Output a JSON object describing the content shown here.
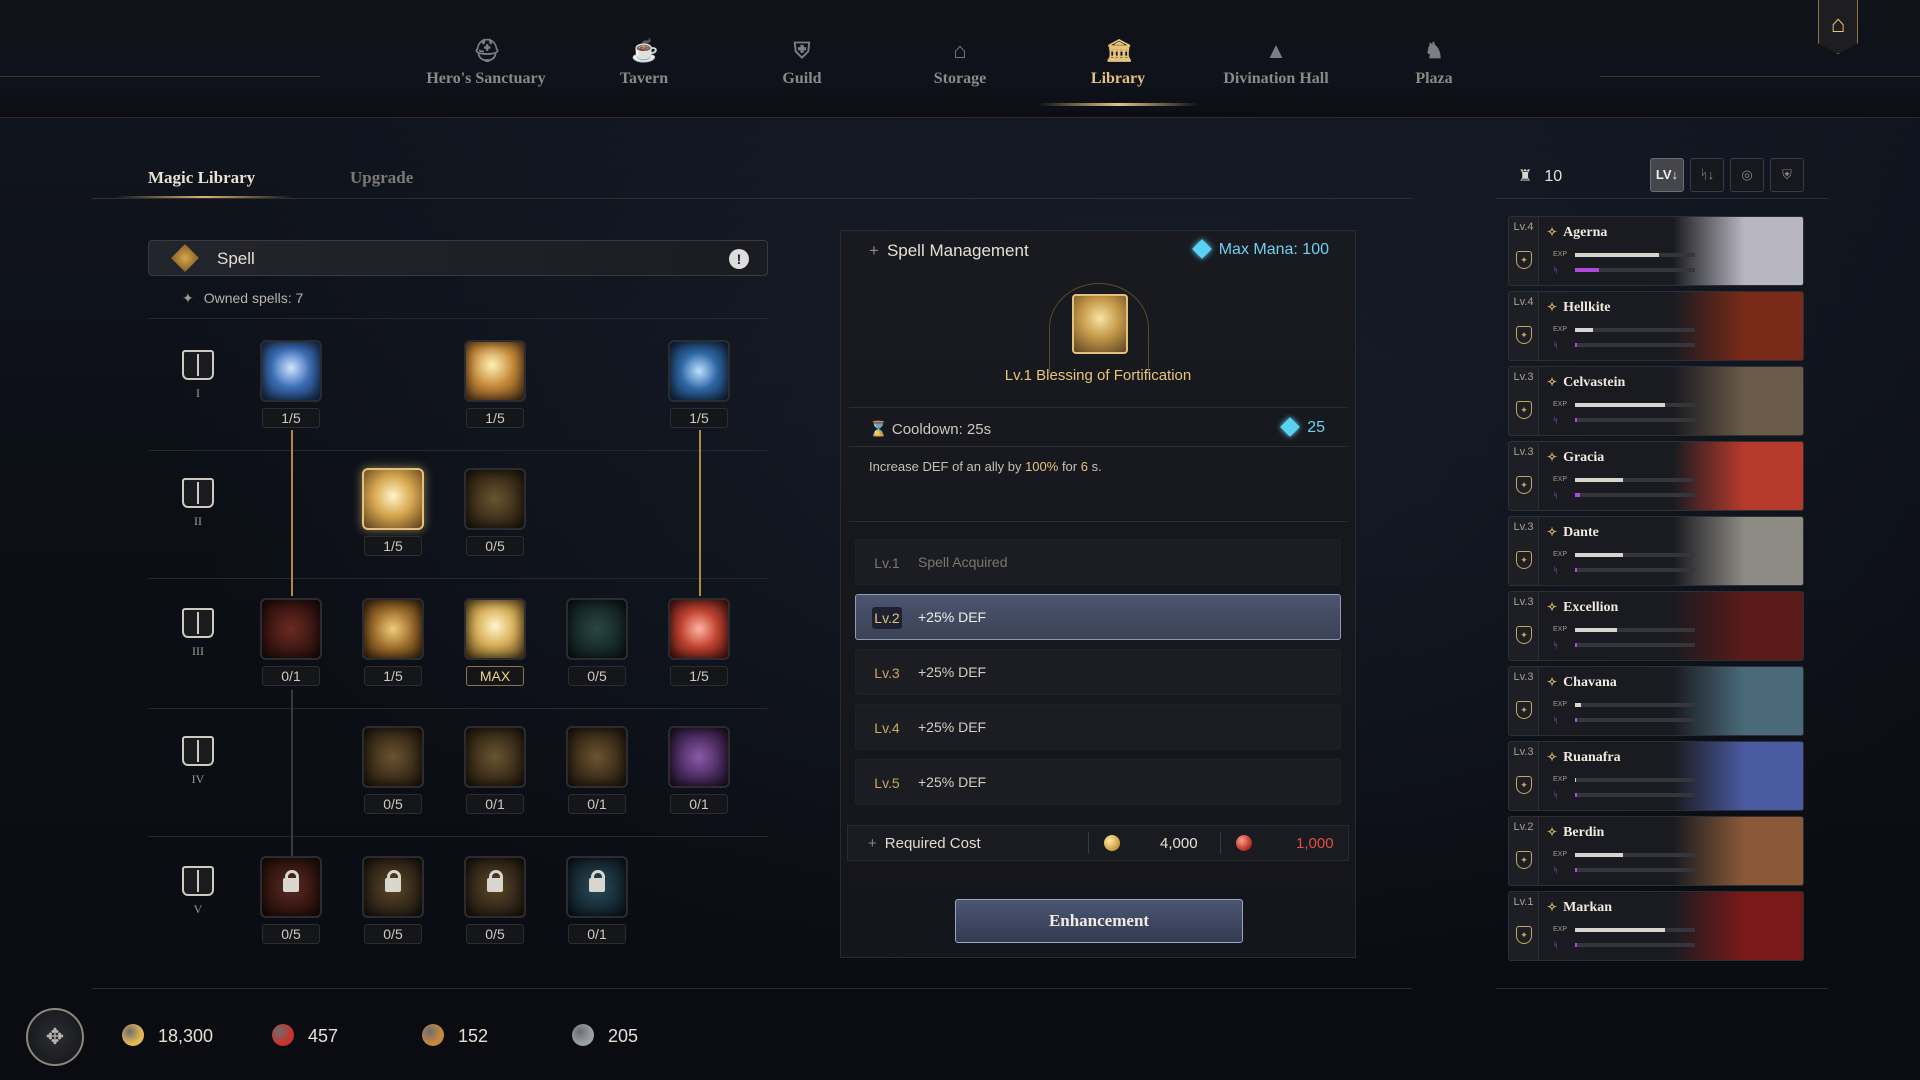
{
  "nav": {
    "items": [
      {
        "label": "Hero's Sanctuary",
        "icon": "helmet-icon"
      },
      {
        "label": "Tavern",
        "icon": "mug-icon"
      },
      {
        "label": "Guild",
        "icon": "shield-icon"
      },
      {
        "label": "Storage",
        "icon": "vault-icon"
      },
      {
        "label": "Library",
        "icon": "library-icon"
      },
      {
        "label": "Divination Hall",
        "icon": "witch-hat-icon"
      },
      {
        "label": "Plaza",
        "icon": "dragon-statue-icon"
      }
    ],
    "active": "Library"
  },
  "tabs": {
    "magic_library": "Magic Library",
    "upgrade": "Upgrade"
  },
  "spell_panel": {
    "title": "Spell",
    "owned": "Owned spells: 7",
    "tiers": [
      "I",
      "II",
      "III",
      "IV",
      "V"
    ],
    "nodes": [
      {
        "tier": "I",
        "count": "1/5",
        "color": "blue-swirl"
      },
      {
        "tier": "I",
        "count": "1/5",
        "color": "gold-burst"
      },
      {
        "tier": "I",
        "count": "1/5",
        "color": "blue-wave"
      },
      {
        "tier": "II",
        "count": "1/5",
        "color": "gold-figure",
        "selected": true
      },
      {
        "tier": "II",
        "count": "0/5",
        "color": "bronze"
      },
      {
        "tier": "III",
        "count": "0/1",
        "color": "dark-red"
      },
      {
        "tier": "III",
        "count": "1/5",
        "color": "gold-rune"
      },
      {
        "tier": "III",
        "count": "MAX",
        "color": "gold-wing"
      },
      {
        "tier": "III",
        "count": "0/5",
        "color": "dark-teal"
      },
      {
        "tier": "III",
        "count": "1/5",
        "color": "red-shield"
      },
      {
        "tier": "IV",
        "count": "0/5",
        "color": "bronze"
      },
      {
        "tier": "IV",
        "count": "0/1",
        "color": "bronze"
      },
      {
        "tier": "IV",
        "count": "0/1",
        "color": "bronze"
      },
      {
        "tier": "IV",
        "count": "0/1",
        "color": "purple"
      },
      {
        "tier": "V",
        "count": "0/5",
        "color": "red-locked"
      },
      {
        "tier": "V",
        "count": "0/5",
        "color": "bronze-locked"
      },
      {
        "tier": "V",
        "count": "0/5",
        "color": "bronze-locked"
      },
      {
        "tier": "V",
        "count": "0/1",
        "color": "teal-locked"
      }
    ]
  },
  "management": {
    "title": "Spell Management",
    "max_mana": "Max Mana: 100",
    "spell_name": "Lv.1 Blessing of Fortification",
    "cooldown": "Cooldown: 25s",
    "mana_cost": "25",
    "desc": {
      "a": "Increase DEF of  an ally by ",
      "b": "100%",
      "c": " for ",
      "d": "6",
      "e": " s."
    },
    "levels": [
      {
        "lv": "Lv.1",
        "effect": "Spell Acquired",
        "state": "done"
      },
      {
        "lv": "Lv.2",
        "effect": "+25% DEF",
        "state": "current"
      },
      {
        "lv": "Lv.3",
        "effect": "+25% DEF",
        "state": "next"
      },
      {
        "lv": "Lv.4",
        "effect": "+25% DEF",
        "state": "next"
      },
      {
        "lv": "Lv.5",
        "effect": "+25% DEF",
        "state": "next"
      }
    ],
    "required_cost": "Required Cost",
    "gold_cost": "4,000",
    "red_cost": "1,000",
    "button": "Enhancement"
  },
  "roster": {
    "count": "10",
    "sort_buttons": [
      "LV↓",
      "ᛋ↓",
      "◎",
      "⛨"
    ],
    "exp_label": "EXP",
    "heroes": [
      {
        "lv": "Lv.4",
        "name": "Agerna",
        "exp": 0.7,
        "mana": 0.2,
        "bg": "#b8b6c0"
      },
      {
        "lv": "Lv.4",
        "name": "Hellkite",
        "exp": 0.15,
        "mana": 0.02,
        "bg": "#7a2a18"
      },
      {
        "lv": "Lv.3",
        "name": "Celvastein",
        "exp": 0.75,
        "mana": 0.02,
        "bg": "#6a5a48"
      },
      {
        "lv": "Lv.3",
        "name": "Gracia",
        "exp": 0.4,
        "mana": 0.04,
        "bg": "#b83a2c"
      },
      {
        "lv": "Lv.3",
        "name": "Dante",
        "exp": 0.4,
        "mana": 0.02,
        "bg": "#8e8a84"
      },
      {
        "lv": "Lv.3",
        "name": "Excellion",
        "exp": 0.35,
        "mana": 0.02,
        "bg": "#5a1a18"
      },
      {
        "lv": "Lv.3",
        "name": "Chavana",
        "exp": 0.05,
        "mana": 0.02,
        "bg": "#4a6a7a"
      },
      {
        "lv": "Lv.3",
        "name": "Ruanafra",
        "exp": 0.01,
        "mana": 0.02,
        "bg": "#4a5aa0"
      },
      {
        "lv": "Lv.2",
        "name": "Berdin",
        "exp": 0.4,
        "mana": 0.02,
        "bg": "#8a5a38"
      },
      {
        "lv": "Lv.1",
        "name": "Markan",
        "exp": 0.75,
        "mana": 0.02,
        "bg": "#7a1a18"
      }
    ]
  },
  "resources": [
    {
      "icon": "gold-coin-icon",
      "value": "18,300",
      "color": "#e6b852"
    },
    {
      "icon": "red-gem-icon",
      "value": "457",
      "color": "#c8332a"
    },
    {
      "icon": "scroll-icon",
      "value": "152",
      "color": "#c8883a"
    },
    {
      "icon": "feather-icon",
      "value": "205",
      "color": "#9aa0a8"
    }
  ]
}
